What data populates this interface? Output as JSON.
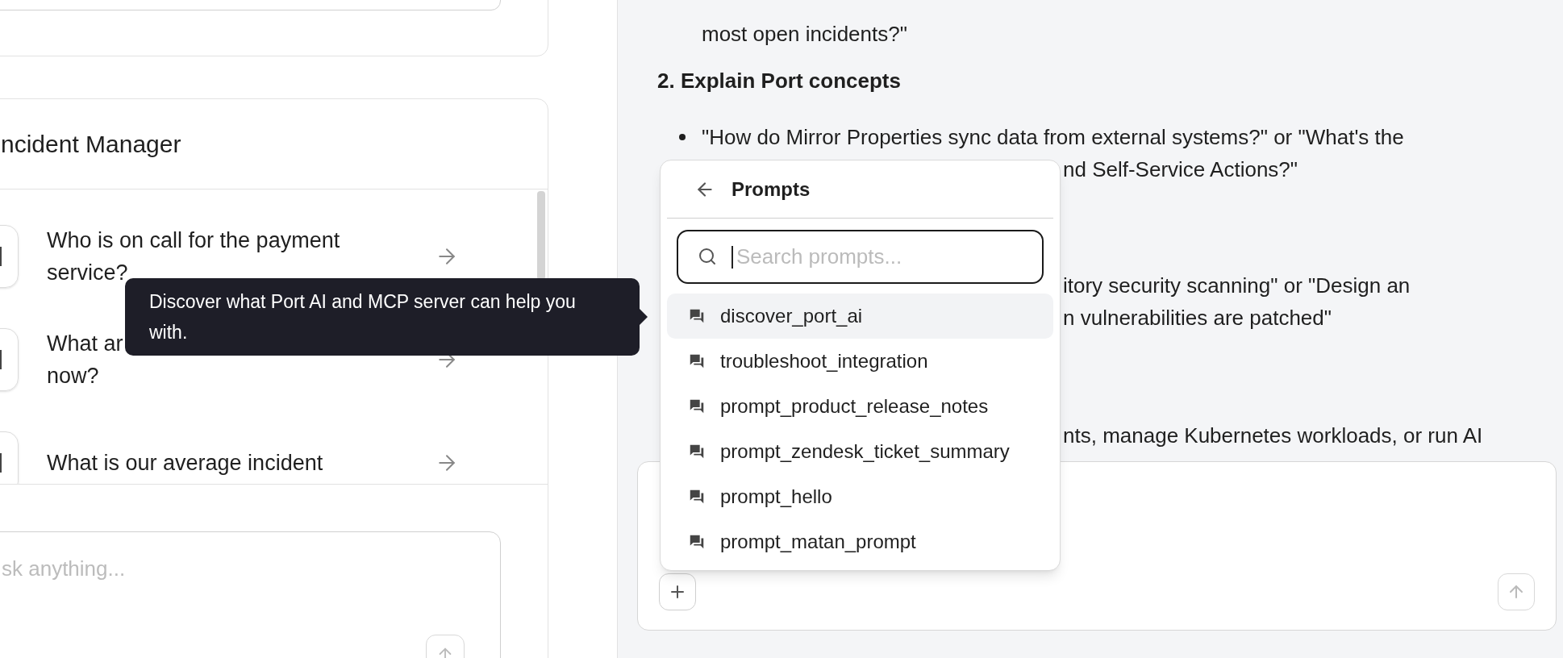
{
  "left_panel": {
    "card_title": "ncident Manager",
    "questions": [
      {
        "lines": [
          "Who is on call for the payment",
          "service?"
        ]
      },
      {
        "lines": [
          "What ar",
          "now?"
        ]
      },
      {
        "lines": [
          "What is our average incident"
        ]
      }
    ],
    "chat_input": {
      "placeholder": "sk anything..."
    }
  },
  "tooltip": "Discover what Port AI and MCP server can help you with.",
  "chat": {
    "blocks": [
      {
        "kind": "indent",
        "text": "most open incidents?\""
      },
      {
        "kind": "heading",
        "text": "2. Explain Port concepts"
      },
      {
        "kind": "bullet",
        "text": "\"How do Mirror Properties sync data from external systems?\" or \"What's the"
      },
      {
        "kind": "fragment",
        "text": "nd Self-Service Actions?\""
      },
      {
        "kind": "fragment",
        "text": "itory security scanning\" or \"Design an"
      },
      {
        "kind": "fragment",
        "text": "n vulnerabilities are patched\""
      },
      {
        "kind": "fragment",
        "text": "nts, manage Kubernetes workloads, or run AI"
      }
    ]
  },
  "prompts_menu": {
    "title": "Prompts",
    "search": {
      "placeholder": "Search prompts..."
    },
    "items": [
      {
        "label": "discover_port_ai",
        "selected": true
      },
      {
        "label": "troubleshoot_integration",
        "selected": false
      },
      {
        "label": "prompt_product_release_notes",
        "selected": false
      },
      {
        "label": "prompt_zendesk_ticket_summary",
        "selected": false
      },
      {
        "label": "prompt_hello",
        "selected": false
      },
      {
        "label": "prompt_matan_prompt",
        "selected": false
      }
    ]
  }
}
